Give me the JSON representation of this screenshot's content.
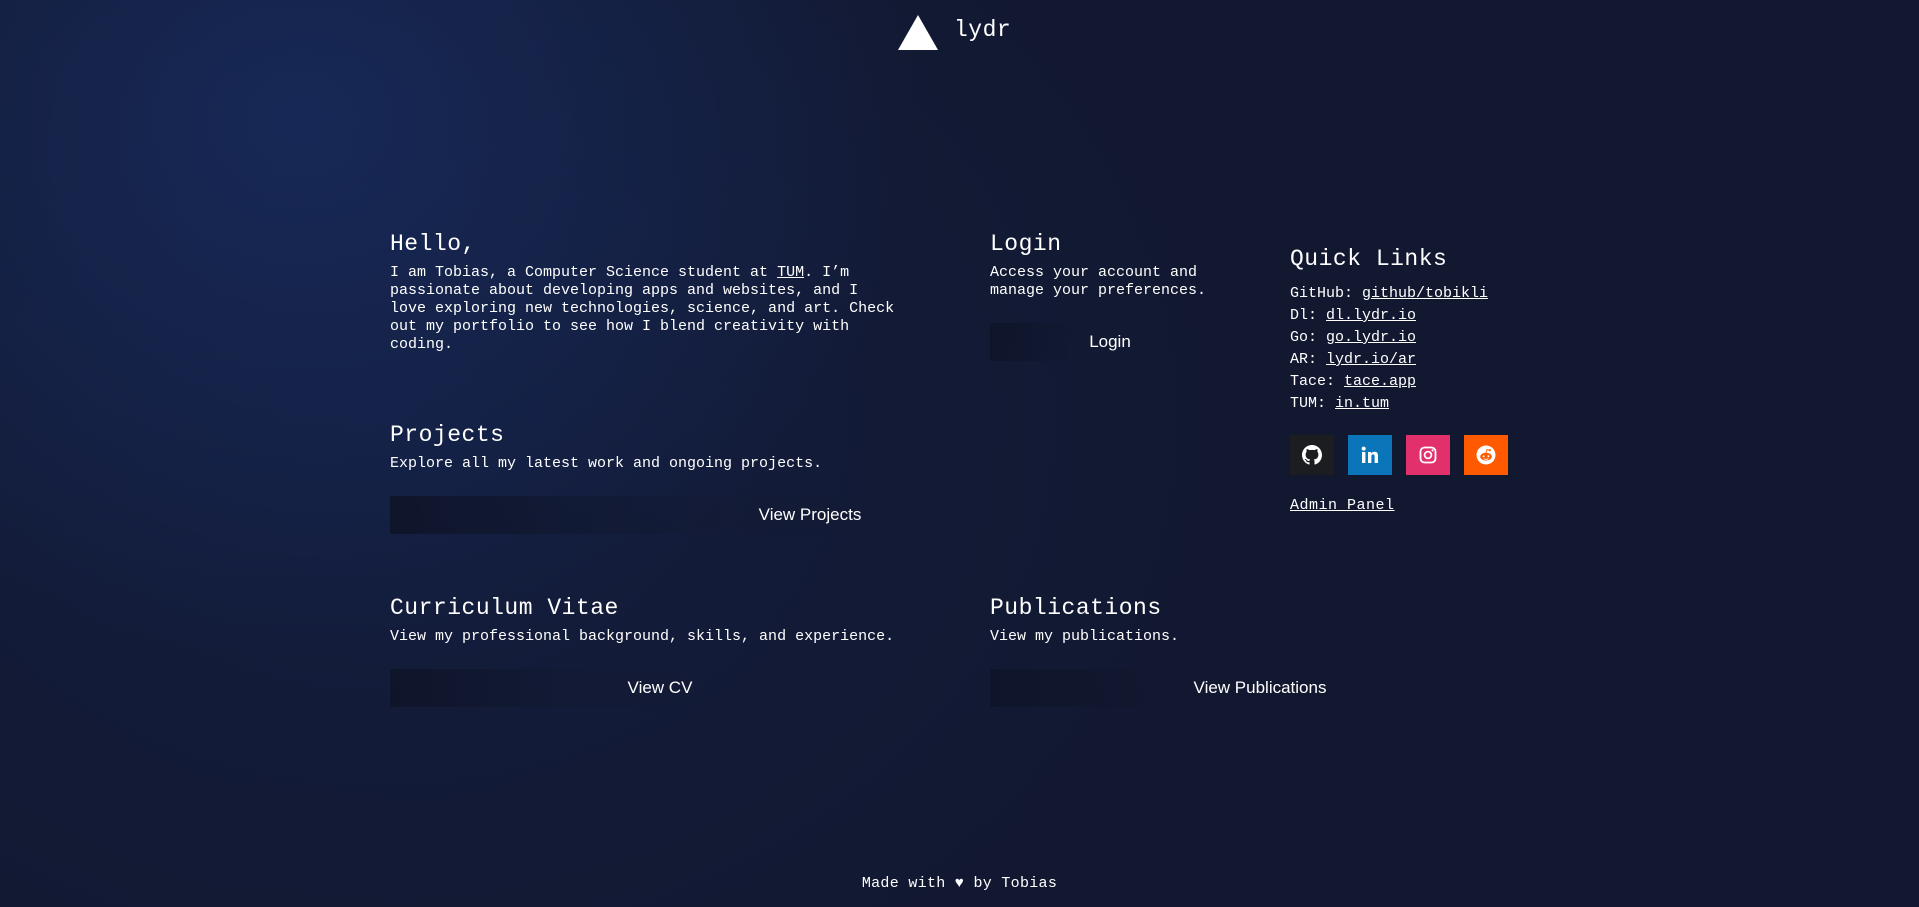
{
  "header": {
    "brand": "lydr",
    "logo_icon": "triangle-logo-icon"
  },
  "hello": {
    "title": "Hello,",
    "text_before": "I am Tobias, a Computer Science student at ",
    "link": "TUM",
    "text_after": ". I’m\npassionate about developing apps and websites, and I\nlove exploring new technologies, science, and art. Check\nout my portfolio to see how I blend creativity with\ncoding."
  },
  "login": {
    "title": "Login",
    "text": "Access your account and\nmanage your preferences.",
    "button": "Login"
  },
  "projects": {
    "title": "Projects",
    "text": "Explore all my latest work and ongoing projects.",
    "button": "View Projects"
  },
  "cv": {
    "title": "Curriculum Vitae",
    "text": "View my professional background, skills, and experience.",
    "button": "View CV"
  },
  "publications": {
    "title": "Publications",
    "text": "View my publications.",
    "button": "View Publications"
  },
  "quick_links": {
    "title": "Quick Links",
    "items": [
      {
        "label": "GitHub:",
        "link": "github/tobikli"
      },
      {
        "label": "Dl:",
        "link": "dl.lydr.io"
      },
      {
        "label": "Go:",
        "link": "go.lydr.io"
      },
      {
        "label": "AR:",
        "link": "lydr.io/ar"
      },
      {
        "label": "Tace:",
        "link": "tace.app"
      },
      {
        "label": "TUM:",
        "link": "in.tum"
      }
    ],
    "social": [
      {
        "icon": "github-icon",
        "color": "#1c1d21"
      },
      {
        "icon": "linkedin-icon",
        "color": "#0a75b8"
      },
      {
        "icon": "instagram-icon",
        "color": "#e1306c"
      },
      {
        "icon": "reddit-icon",
        "color": "#ff5a00"
      }
    ],
    "admin": "Admin Panel"
  },
  "footer": {
    "text": "Made with ♥ by Tobias"
  }
}
